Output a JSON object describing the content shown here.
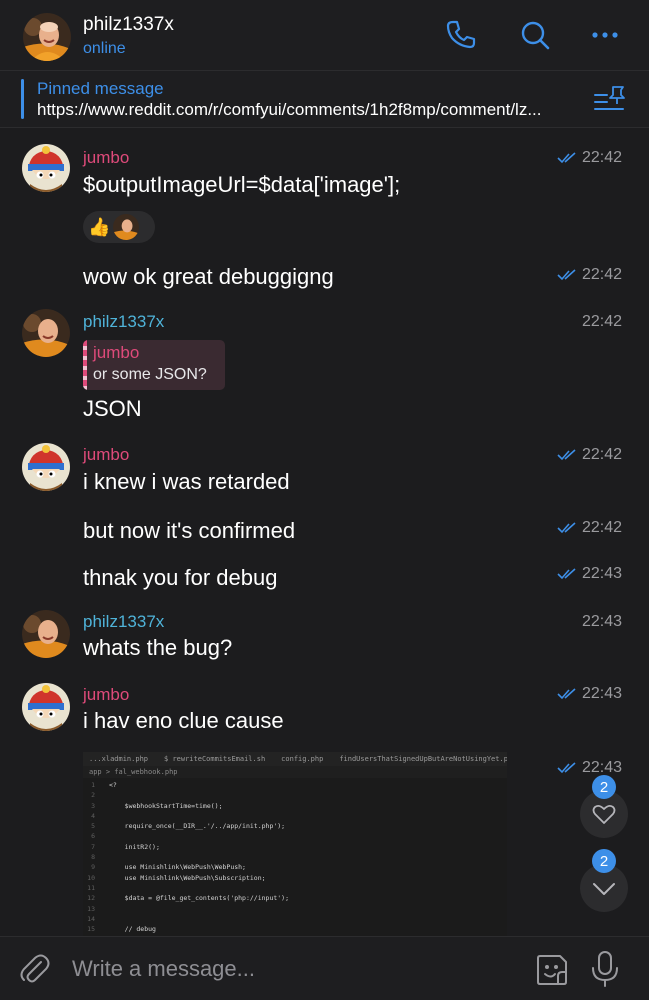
{
  "header": {
    "name": "philz1337x",
    "status": "online",
    "icons": [
      "phone-icon",
      "search-icon",
      "more-icon"
    ],
    "accent": "#3d8fe8"
  },
  "pinned": {
    "title": "Pinned message",
    "text": "https://www.reddit.com/r/comfyui/comments/1h2f8mp/comment/lz..."
  },
  "messages": [
    {
      "sender": "jumbo",
      "text": "$outputImageUrl=$data['image'];",
      "time": "22:42",
      "read": true,
      "reactions": [
        "👍"
      ]
    },
    {
      "text": "wow ok great debuggigng",
      "time": "22:42",
      "read": true
    },
    {
      "sender": "philz1337x",
      "reply": {
        "name": "jumbo",
        "text": "or some JSON?"
      },
      "text": "JSON",
      "time": "22:42"
    },
    {
      "sender": "jumbo",
      "text": "i knew i was retarded",
      "time": "22:42",
      "read": true
    },
    {
      "text": "but now it's confirmed",
      "time": "22:42",
      "read": true
    },
    {
      "text": "thnak you for debug",
      "time": "22:43",
      "read": true
    },
    {
      "sender": "philz1337x",
      "text": "whats the bug?",
      "time": "22:43"
    },
    {
      "sender": "jumbo",
      "text": "i hav eno clue cause",
      "time": "22:43",
      "read": true
    },
    {
      "image": "code-screenshot",
      "time": "22:43",
      "read": true
    }
  ],
  "code_image": {
    "tabs": [
      "...xladmin.php",
      "$ rewriteCommitsEmail.sh",
      "config.php",
      "findUsersThatSignedUpButAreNotUsingYet.php"
    ],
    "path": "app > fal_webhook.php",
    "lines": [
      {
        "n": "1",
        "code": "<?"
      },
      {
        "n": "2",
        "code": ""
      },
      {
        "n": "3",
        "code": "    $webhookStartTime=time();"
      },
      {
        "n": "4",
        "code": ""
      },
      {
        "n": "5",
        "code": "    require_once(__DIR__.'/../app/init.php');"
      },
      {
        "n": "6",
        "code": ""
      },
      {
        "n": "7",
        "code": "    initR2();"
      },
      {
        "n": "8",
        "code": ""
      },
      {
        "n": "9",
        "code": "    use Minishlink\\WebPush\\WebPush;"
      },
      {
        "n": "10",
        "code": "    use Minishlink\\WebPush\\Subscription;"
      },
      {
        "n": "11",
        "code": ""
      },
      {
        "n": "12",
        "code": "    $data = @file_get_contents('php://input');"
      },
      {
        "n": "13",
        "code": ""
      },
      {
        "n": "14",
        "code": ""
      },
      {
        "n": "15",
        "code": "    // debug"
      }
    ]
  },
  "floating": {
    "reactions_badge": "2",
    "scroll_badge": "2"
  },
  "input": {
    "placeholder": "Write a message..."
  },
  "colors": {
    "background": "#1c1c1e",
    "bar": "#1e1e20",
    "sender_pink": "#de4a7a",
    "sender_blue": "#4fb3d9",
    "time": "#9a9a9e"
  }
}
